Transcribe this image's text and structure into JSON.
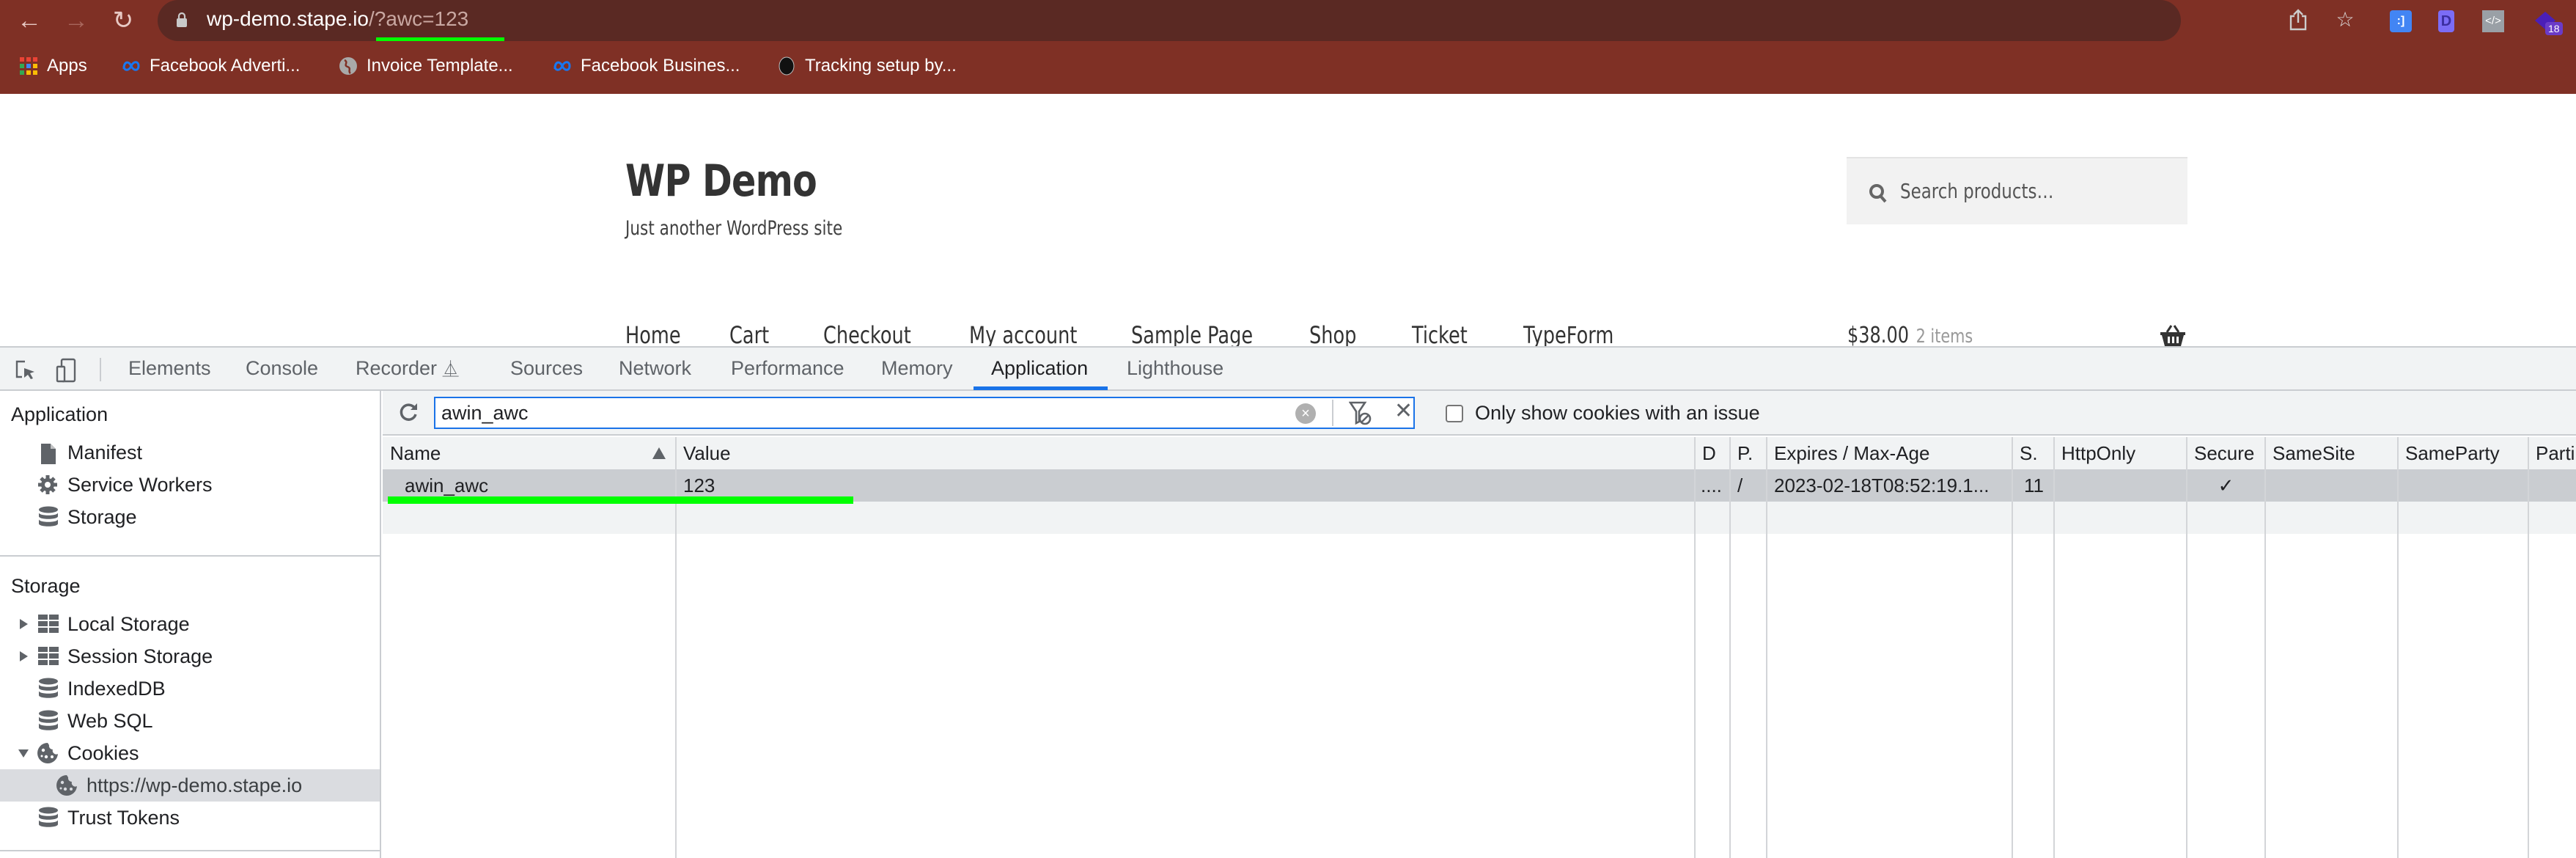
{
  "browser": {
    "url_host": "wp-demo.stape.io",
    "url_query": "/?awc=123",
    "extension_badge": "18",
    "bookmarks": [
      {
        "label": "Apps",
        "icon": "apps-grid-icon"
      },
      {
        "label": "Facebook Adverti...",
        "icon": "meta-icon"
      },
      {
        "label": "Invoice Template...",
        "icon": "globe-icon"
      },
      {
        "label": "Facebook Busines...",
        "icon": "meta-icon"
      },
      {
        "label": "Tracking setup by...",
        "icon": "black-circle-icon"
      }
    ]
  },
  "page": {
    "site_title": "WP Demo",
    "tagline": "Just another WordPress site",
    "search_placeholder": "Search products…",
    "nav": [
      "Home",
      "Cart",
      "Checkout",
      "My account",
      "Sample Page",
      "Shop",
      "Ticket",
      "TypeForm"
    ],
    "cart_total": "$38.00",
    "cart_count": "2 items"
  },
  "devtools": {
    "tabs": [
      "Elements",
      "Console",
      "Recorder",
      "Sources",
      "Network",
      "Performance",
      "Memory",
      "Application",
      "Lighthouse"
    ],
    "active_tab": "Application",
    "sidebar": {
      "application_heading": "Application",
      "application_items": [
        "Manifest",
        "Service Workers",
        "Storage"
      ],
      "storage_heading": "Storage",
      "storage_items": [
        {
          "label": "Local Storage",
          "expandable": true,
          "expanded": false
        },
        {
          "label": "Session Storage",
          "expandable": true,
          "expanded": false
        },
        {
          "label": "IndexedDB"
        },
        {
          "label": "Web SQL"
        },
        {
          "label": "Cookies",
          "expandable": true,
          "expanded": true
        },
        {
          "label": "https://wp-demo.stape.io",
          "selected": true
        },
        {
          "label": "Trust Tokens"
        }
      ]
    },
    "cookies": {
      "filter_value": "awin_awc",
      "only_issue_label": "Only show cookies with an issue",
      "only_issue_checked": false,
      "columns": [
        "Name",
        "Value",
        "D",
        "P.",
        "Expires / Max-Age",
        "S.",
        "HttpOnly",
        "Secure",
        "SameSite",
        "SameParty",
        "Parti"
      ],
      "sort_column": "Name",
      "rows": [
        {
          "name": "awin_awc",
          "value": "123",
          "domain": "....",
          "path": "/",
          "expires": "2023-02-18T08:52:19.1...",
          "size": "11",
          "httponly": "",
          "secure": "✓",
          "samesite": "",
          "sameparty": "",
          "partition": ""
        }
      ]
    }
  },
  "colors": {
    "chrome_bg": "#7f3025",
    "highlight": "#00ff00",
    "devtools_accent": "#1a73e8"
  }
}
